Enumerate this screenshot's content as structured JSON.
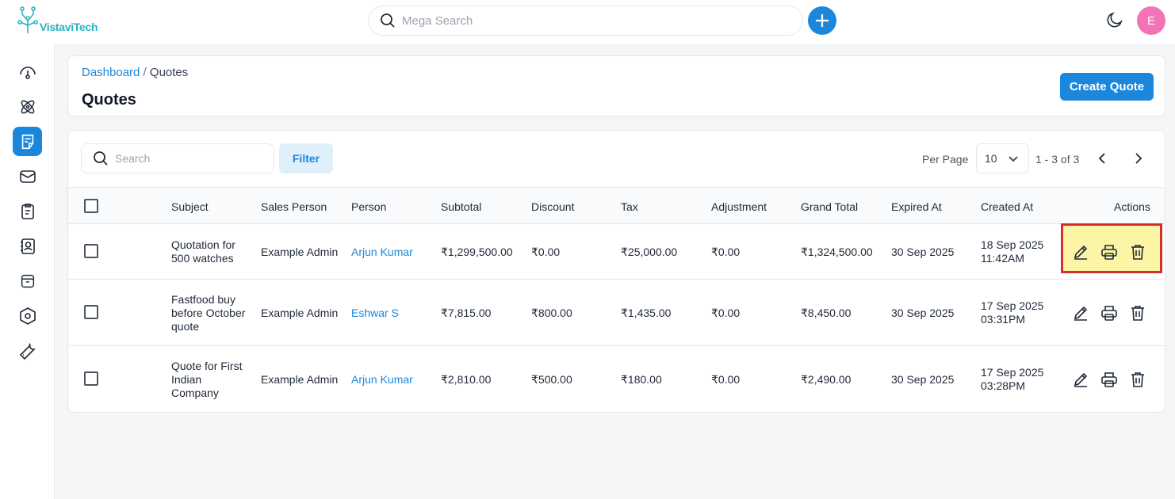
{
  "app": {
    "logo_text": "VistaviTech",
    "mega_search_placeholder": "Mega Search",
    "avatar_initial": "E",
    "accent_color": "#1a87dc"
  },
  "sidebar": {
    "items": [
      {
        "icon": "dashboard-gauge-icon"
      },
      {
        "icon": "leads-atom-icon"
      },
      {
        "icon": "quotes-note-icon",
        "active": true
      },
      {
        "icon": "mail-icon"
      },
      {
        "icon": "activities-clipboard-icon"
      },
      {
        "icon": "contacts-person-icon"
      },
      {
        "icon": "products-archive-icon"
      },
      {
        "icon": "settings-hexagon-icon"
      },
      {
        "icon": "configuration-wrench-icon"
      }
    ]
  },
  "header": {
    "breadcrumb_link": "Dashboard",
    "breadcrumb_sep": " / ",
    "breadcrumb_current": "Quotes",
    "title": "Quotes",
    "create_label": "Create Quote"
  },
  "toolbar": {
    "search_placeholder": "Search",
    "filter_label": "Filter",
    "per_page_label": "Per Page",
    "per_page_value": "10",
    "pagination_info": "1 - 3 of 3"
  },
  "table": {
    "columns": [
      "Subject",
      "Sales Person",
      "Person",
      "Subtotal",
      "Discount",
      "Tax",
      "Adjustment",
      "Grand Total",
      "Expired At",
      "Created At",
      "Actions"
    ],
    "rows": [
      {
        "subject": [
          "Quotation for",
          "500 watches"
        ],
        "sales_person": "Example Admin",
        "person": "Arjun Kumar",
        "subtotal": "₹1,299,500.00",
        "discount": "₹0.00",
        "tax": "₹25,000.00",
        "adjustment": "₹0.00",
        "grand_total": "₹1,324,500.00",
        "expired_at": "30 Sep 2025",
        "created_at": [
          "18 Sep 2025",
          "11:42AM"
        ],
        "highlighted": true
      },
      {
        "subject": [
          "Fastfood buy",
          "before October",
          "quote"
        ],
        "sales_person": "Example Admin",
        "person": "Eshwar S",
        "subtotal": "₹7,815.00",
        "discount": "₹800.00",
        "tax": "₹1,435.00",
        "adjustment": "₹0.00",
        "grand_total": "₹8,450.00",
        "expired_at": "30 Sep 2025",
        "created_at": [
          "17 Sep 2025",
          "03:31PM"
        ]
      },
      {
        "subject": [
          "Quote for First",
          "Indian",
          "Company"
        ],
        "sales_person": "Example Admin",
        "person": "Arjun Kumar",
        "subtotal": "₹2,810.00",
        "discount": "₹500.00",
        "tax": "₹180.00",
        "adjustment": "₹0.00",
        "grand_total": "₹2,490.00",
        "expired_at": "30 Sep 2025",
        "created_at": [
          "17 Sep 2025",
          "03:28PM"
        ]
      }
    ]
  }
}
